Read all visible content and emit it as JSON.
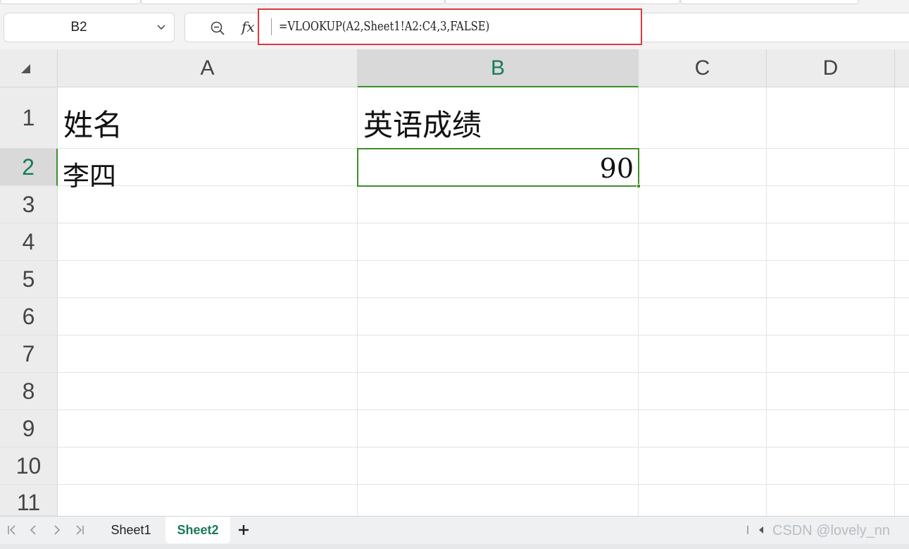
{
  "name_box": {
    "value": "B2"
  },
  "formula_bar": {
    "fx_label": "fx",
    "formula": "=VLOOKUP(A2,Sheet1!A2:C4,3,FALSE)"
  },
  "columns": [
    "A",
    "B",
    "C",
    "D"
  ],
  "rows": [
    "1",
    "2",
    "3",
    "4",
    "5",
    "6",
    "7",
    "8",
    "9",
    "10",
    "11"
  ],
  "selected": {
    "column": "B",
    "row": "2"
  },
  "cells": {
    "A1": "姓名",
    "B1": "英语成绩",
    "A2": "李四",
    "B2": "90"
  },
  "sheet_tabs": [
    {
      "label": "Sheet1",
      "active": false
    },
    {
      "label": "Sheet2",
      "active": true
    }
  ],
  "watermark": "CSDN @lovely_nn",
  "colors": {
    "selection": "#3f8f2a",
    "accent_text": "#167a5c",
    "highlight_box": "#e0383e"
  }
}
